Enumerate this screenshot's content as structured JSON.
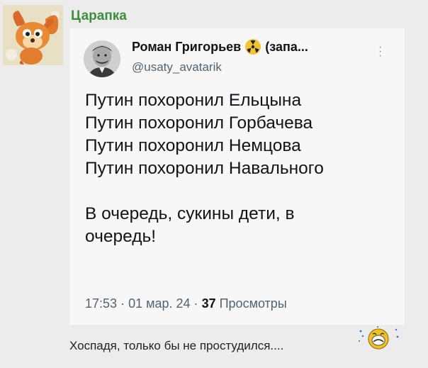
{
  "post": {
    "author": "Царапка",
    "comment": "Хоспадя, только бы не простудился....",
    "smiley": "sad-smiley-icon"
  },
  "tweet": {
    "name": "Роман Григорьев",
    "name_suffix": "(запа...",
    "name_badge": "radioactive-icon",
    "handle": "@usaty_avatarik",
    "more_icon": "vertical-dots-icon",
    "lines": [
      "Путин похоронил Ельцына",
      "Путин похоронил Горбачева",
      "Путин похоронил Немцова",
      "Путин похоронил Навального",
      "",
      "В очередь, сукины дети, в",
      "очередь!"
    ],
    "time": "17:53",
    "date": "01 мар. 24",
    "separator": "·",
    "views_count": "37",
    "views_label": "Просмотры"
  },
  "colors": {
    "author": "#3c8f3d",
    "page_bg": "#ececec",
    "card_bg": "#f7f7f7",
    "muted": "#536471"
  }
}
